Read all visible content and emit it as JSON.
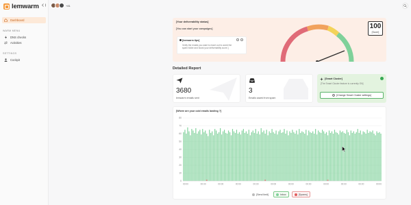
{
  "app": {
    "logo_text": "lemwarm"
  },
  "topbar": {
    "collapse_icon": "chevron-left-icon",
    "more_users": "+81",
    "search_icon": "search-icon"
  },
  "sidebar": {
    "dashboard": "Dashboard",
    "section_warm": "WARM MENU",
    "dns_checks": "DNS checks",
    "activities": "Activities",
    "section_settings": "SETTINGS",
    "cockpit": "Cockpit"
  },
  "status": {
    "title": "[Your deliverability status]",
    "subtitle": "[You can start your campaigns]",
    "tip_title": "[lemwarm tips]",
    "tip_text": "Verify the emails you want to reach out to avoid the spam folder and boost your deliverability score.]",
    "score_value": "100",
    "score_label": "[Score]"
  },
  "report": {
    "title": "Detailed Report",
    "emails_sent_value": "3680",
    "emails_sent_label": "lemwarm emails sent",
    "saved_value": "3",
    "saved_label": "Emails saved from spam",
    "cluster_title": "[Smart Cluster]",
    "cluster_sub": "[The Smart Cluster feature is currently ON]",
    "cluster_button": "[Change Smart Cluster settings]"
  },
  "colors": {
    "accent": "#f59a3c",
    "inbox": "#7fd19a",
    "spam": "#e05a5a",
    "send_limit": "#bbbbbb"
  },
  "chart_data": {
    "type": "bar",
    "title": "[Where are your cold emails landing ?]",
    "ylim": [
      0,
      80
    ],
    "yticks": [
      "0",
      "10",
      "20",
      "30",
      "40",
      "50",
      "60",
      "70",
      "80"
    ],
    "xticks": [
      "00:00",
      "00:00",
      "00:00",
      "00:00",
      "00:00",
      "00:00",
      "00:00",
      "00:00",
      "00:00",
      "00:00",
      "00:00",
      "00:00"
    ],
    "legend": {
      "send_limit": "[Send limit]",
      "inbox": "Inbox",
      "spams": "[Spams]"
    },
    "series": [
      {
        "name": "Inbox",
        "values": [
          62,
          65,
          60,
          68,
          63,
          58,
          66,
          64,
          61,
          67,
          60,
          63,
          65,
          59,
          66,
          62,
          64,
          60,
          57,
          65,
          61,
          63,
          58,
          66,
          64,
          60,
          62,
          67,
          59,
          63,
          65,
          61,
          60,
          64,
          62,
          58,
          66,
          63,
          61,
          65,
          60,
          62,
          59,
          64,
          66,
          61,
          63,
          60,
          65,
          58,
          62,
          64,
          61,
          66,
          60,
          63,
          59,
          67,
          62,
          64,
          60,
          65,
          58,
          63,
          61,
          66,
          62,
          60,
          64,
          59,
          63,
          65,
          61,
          62,
          66,
          60,
          64,
          58,
          63,
          61,
          65,
          62,
          60,
          64,
          59,
          66,
          61,
          63,
          62,
          60,
          65,
          58,
          64,
          62,
          61,
          63,
          60,
          66,
          59,
          64,
          62,
          61,
          65,
          63,
          60,
          62,
          58,
          64,
          61,
          63,
          60,
          65,
          62,
          61,
          59,
          64,
          62,
          63,
          61,
          60,
          65,
          62,
          58,
          64,
          61,
          63,
          60,
          62,
          66,
          61,
          64,
          59,
          63,
          62,
          60,
          65,
          61,
          63,
          62,
          64,
          60,
          58,
          63,
          61,
          62,
          60
        ]
      },
      {
        "name": "[Spams]",
        "values": [
          0,
          0,
          0,
          0,
          0,
          0,
          0,
          0,
          0,
          0,
          0,
          0,
          0,
          0,
          0,
          0,
          0,
          1,
          0,
          0,
          0,
          0,
          0,
          0,
          0,
          0,
          0,
          0,
          0,
          0,
          0,
          0,
          0,
          0,
          0,
          0,
          0,
          0,
          0,
          0,
          0,
          0,
          0,
          0,
          0,
          0,
          0,
          0,
          0,
          0,
          0,
          0,
          0,
          0,
          0,
          0,
          0,
          0,
          0,
          0,
          1,
          0,
          0,
          0,
          0,
          0,
          0,
          0,
          0,
          0,
          0,
          0,
          0,
          0,
          0,
          0,
          0,
          0,
          0,
          0,
          0,
          0,
          0,
          0,
          0,
          0,
          0,
          0,
          0,
          0,
          0,
          0,
          0,
          0,
          0,
          0,
          0,
          0,
          0,
          0,
          0,
          0,
          0,
          0,
          0,
          0,
          1,
          0,
          0,
          0,
          0,
          0,
          0,
          0,
          0,
          0,
          0,
          0,
          0,
          0,
          0,
          0,
          0,
          0,
          0,
          0,
          0,
          0,
          0,
          0,
          0,
          0,
          0,
          0,
          0,
          0,
          0,
          0,
          0,
          0,
          0,
          0,
          0,
          0,
          0,
          0,
          0,
          0,
          0,
          0,
          0,
          0
        ]
      }
    ]
  }
}
